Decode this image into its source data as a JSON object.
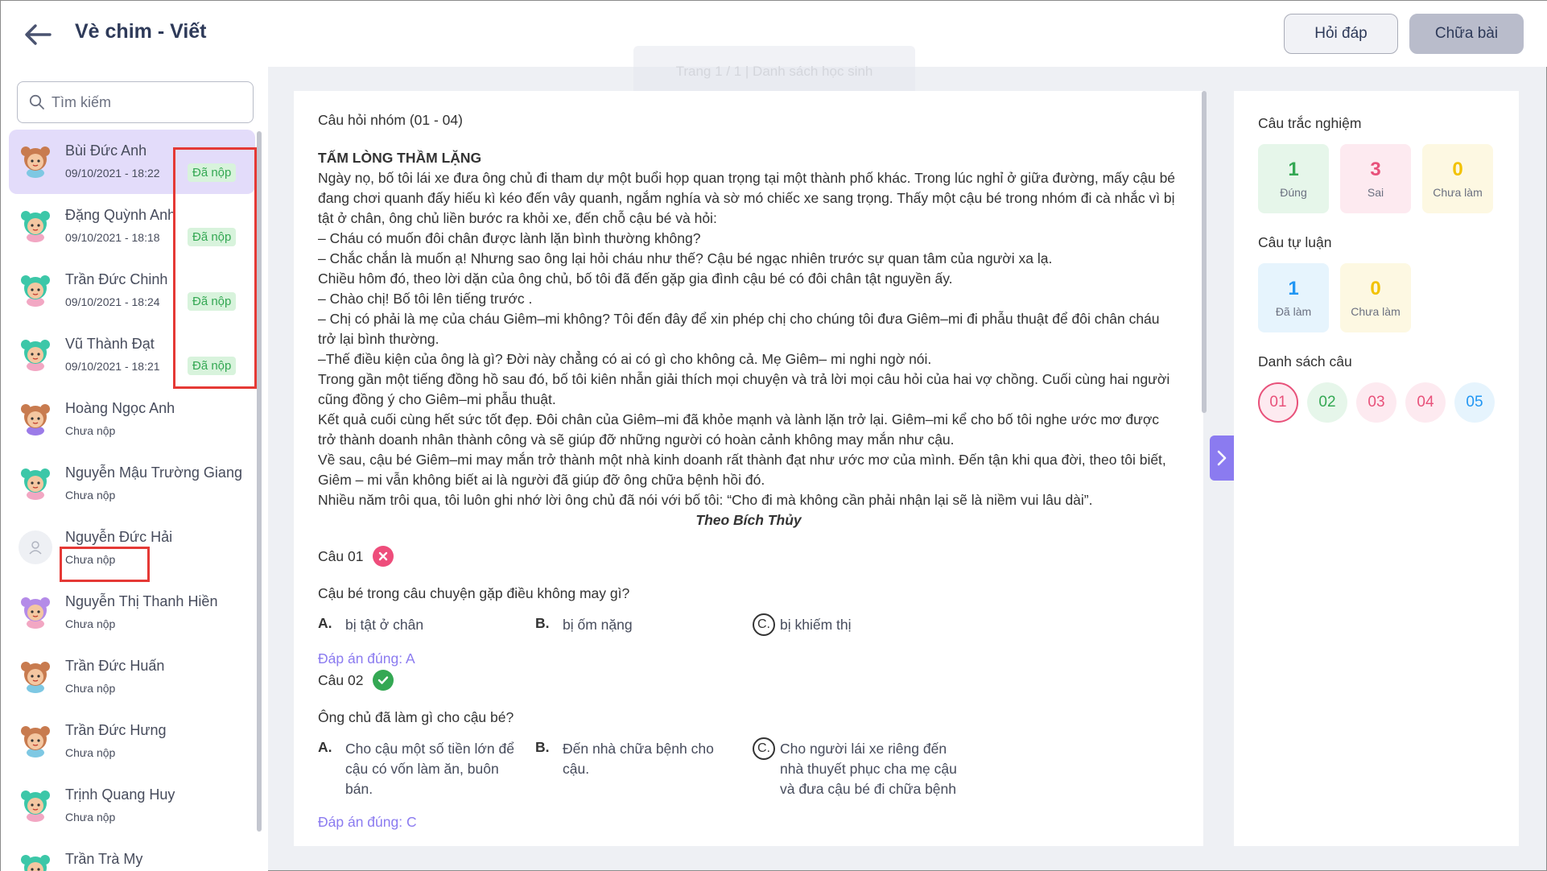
{
  "header": {
    "title": "Vè chim - Viết",
    "hoidap_label": "Hỏi đáp",
    "chuabai_label": "Chữa bài",
    "ghost_text": "Trang 1 / 1  |  Danh sách học sinh"
  },
  "search": {
    "placeholder": "Tìm kiếm"
  },
  "students": [
    {
      "name": "Bùi Đức Anh",
      "sub": "09/10/2021 - 18:22",
      "badge": "Đã nộp",
      "avatar": "bear"
    },
    {
      "name": "Đặng Quỳnh Anh",
      "sub": "09/10/2021 - 18:18",
      "badge": "Đã nộp",
      "avatar": "frog"
    },
    {
      "name": "Trần Đức Chinh",
      "sub": "09/10/2021 - 18:24",
      "badge": "Đã nộp",
      "avatar": "frog"
    },
    {
      "name": "Vũ Thành Đạt",
      "sub": "09/10/2021 - 18:21",
      "badge": "Đã nộp",
      "avatar": "frog"
    },
    {
      "name": "Hoàng Ngọc Anh",
      "sub": "Chưa nộp",
      "badge": "",
      "avatar": "bear-purple"
    },
    {
      "name": "Nguyễn Mậu Trường Giang",
      "sub": "Chưa nộp",
      "badge": "",
      "avatar": "frog"
    },
    {
      "name": "Nguyễn Đức Hải",
      "sub": "Chưa nộp",
      "badge": "",
      "avatar": "empty"
    },
    {
      "name": "Nguyễn Thị Thanh Hiền",
      "sub": "Chưa nộp",
      "badge": "",
      "avatar": "bunny"
    },
    {
      "name": "Trần Đức Huấn",
      "sub": "Chưa nộp",
      "badge": "",
      "avatar": "bear"
    },
    {
      "name": "Trần Đức Hưng",
      "sub": "Chưa nộp",
      "badge": "",
      "avatar": "bear"
    },
    {
      "name": "Trịnh Quang Huy",
      "sub": "Chưa nộp",
      "badge": "",
      "avatar": "frog"
    },
    {
      "name": "Trần Trà My",
      "sub": "",
      "badge": "",
      "avatar": "frog"
    }
  ],
  "content": {
    "group_title": "Câu hỏi nhóm (01 - 04)",
    "passage_title": "TẤM LÒNG THẦM LẶNG",
    "passage": [
      " Ngày nọ, bố tôi lái xe đưa ông chủ đi tham dự một buổi họp quan trọng tại một thành phố khác. Trong lúc nghỉ ở giữa đường, mấy cậu bé đang chơi quanh đấy hiếu kì kéo đến vây quanh, ngắm nghía và sờ mó chiếc xe sang trọng. Thấy một cậu bé trong nhóm đi cà nhắc vì bị tật ở chân, ông chủ liền bước ra khỏi xe, đến chỗ cậu bé và hỏi:",
      "– Cháu có muốn đôi chân được lành lặn bình thường không?",
      "– Chắc chắn là muốn ạ! Nhưng sao ông lại hỏi cháu như thế? Cậu bé ngạc nhiên trước sự quan tâm của người xa lạ.",
      "  Chiều hôm đó, theo lời dặn của ông chủ, bố tôi đã đến gặp gia đình cậu bé có đôi chân tật nguyền ấy.",
      "– Chào chị! Bố tôi lên tiếng trước .",
      "– Chị có phải là mẹ của cháu Giêm–mi không? Tôi đến đây để xin phép chị cho chúng tôi đưa Giêm–mi đi phẫu thuật để đôi chân cháu trở lại bình thường.",
      "–Thế điều kiện của ông là gì? Đời này chẳng có ai có gì cho không cả. Mẹ Giêm– mi nghi ngờ nói.",
      "  Trong gần một tiếng đồng hồ sau đó, bố tôi kiên nhẫn giải thích mọi chuyện và trả lời mọi câu hỏi của hai vợ chồng. Cuối cùng hai người cũng đồng ý cho Giêm–mi phẫu thuật.",
      "Kết quả cuối cùng hết sức tốt đẹp. Đôi chân của Giêm–mi đã khỏe mạnh và lành lặn trở lại. Giêm–mi kể cho bố tôi nghe ước mơ được trở thành doanh nhân thành công và sẽ giúp đỡ những người có hoàn cảnh không may mắn như cậu.",
      "Về sau, cậu bé Giêm–mi may mắn trở thành một nhà kinh doanh rất thành đạt như ước mơ của mình. Đến tận khi qua đời, theo tôi biết, Giêm – mi vẫn không biết ai là người đã giúp đỡ ông chữa bệnh hồi đó.",
      "Nhiều năm trôi qua, tôi luôn ghi nhớ lời ông chủ đã nói với bố tôi: “Cho đi mà không cần phải nhận lại sẽ là niềm vui lâu dài”."
    ],
    "author": "Theo Bích Thủy",
    "questions": [
      {
        "label": "Câu 01",
        "status": "wrong",
        "text": "Cậu bé trong câu chuyện gặp điều không may gì?",
        "options": [
          {
            "key": "A.",
            "text": "bị tật ở chân"
          },
          {
            "key": "B.",
            "text": "bị ốm nặng"
          },
          {
            "key": "C.",
            "text": "bị khiếm thị"
          }
        ],
        "selected_key": "C",
        "answer": "Đáp án đúng: A"
      },
      {
        "label": "Câu 02",
        "status": "correct",
        "text": "Ông chủ đã làm gì cho cậu bé?",
        "options": [
          {
            "key": "A.",
            "text": "Cho cậu một số tiền lớn để cậu có vốn làm ăn, buôn bán."
          },
          {
            "key": "B.",
            "text": "Đến nhà chữa bệnh cho cậu."
          },
          {
            "key": "C.",
            "text": "Cho người lái xe riêng đến nhà thuyết phục cha mẹ cậu và đưa cậu bé đi chữa bệnh"
          }
        ],
        "selected_key": "C",
        "answer": "Đáp án đúng: C"
      }
    ]
  },
  "panel": {
    "mc_title": "Câu trắc nghiệm",
    "mc_stats": [
      {
        "num": "1",
        "label": "Đúng",
        "color": "#34a853",
        "bg": "#e6f6ea"
      },
      {
        "num": "3",
        "label": "Sai",
        "color": "#e8517a",
        "bg": "#fdeaf0"
      },
      {
        "num": "0",
        "label": "Chưa làm",
        "color": "#f2c200",
        "bg": "#fdf8e2"
      }
    ],
    "essay_title": "Câu tự luận",
    "essay_stats": [
      {
        "num": "1",
        "label": "Đã làm",
        "color": "#2196f3",
        "bg": "#e6f4fd"
      },
      {
        "num": "0",
        "label": "Chưa làm",
        "color": "#f2c200",
        "bg": "#fdf8e2"
      }
    ],
    "list_title": "Danh sách câu",
    "list": [
      {
        "label": "01",
        "color": "#e8517a",
        "bg": "#fdeaf0",
        "selected": true
      },
      {
        "label": "02",
        "color": "#34a853",
        "bg": "#e6f6ea",
        "selected": false
      },
      {
        "label": "03",
        "color": "#e8517a",
        "bg": "#fdeaf0",
        "selected": false
      },
      {
        "label": "04",
        "color": "#e8517a",
        "bg": "#fdeaf0",
        "selected": false
      },
      {
        "label": "05",
        "color": "#2196f3",
        "bg": "#e6f4fd",
        "selected": false
      }
    ]
  }
}
